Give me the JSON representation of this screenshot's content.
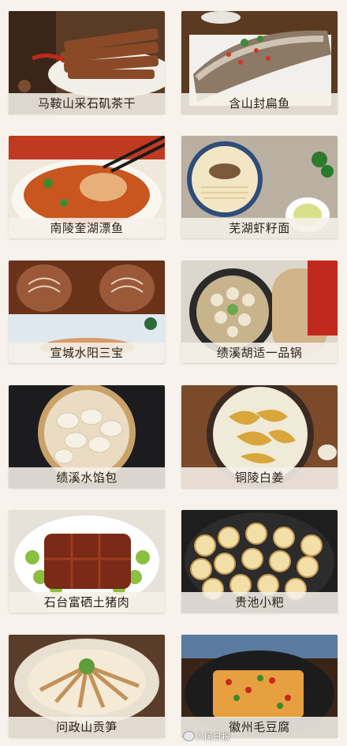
{
  "dishes": [
    {
      "name": "马鞍山采石矶茶干"
    },
    {
      "name": "含山封扁鱼"
    },
    {
      "name": "南陵奎湖漂鱼"
    },
    {
      "name": "芜湖虾籽面"
    },
    {
      "name": "宣城水阳三宝"
    },
    {
      "name": "绩溪胡适一品锅"
    },
    {
      "name": "绩溪水馅包"
    },
    {
      "name": "铜陵白姜"
    },
    {
      "name": "石台富硒土猪肉"
    },
    {
      "name": "贵池小粑"
    },
    {
      "name": "问政山贡笋"
    },
    {
      "name": "徽州毛豆腐"
    }
  ],
  "watermark": {
    "text": "人民日报"
  },
  "colors": {
    "background": "#f7f3ec",
    "label_bg": "#f5f0e8",
    "label_text": "#2a2118"
  }
}
